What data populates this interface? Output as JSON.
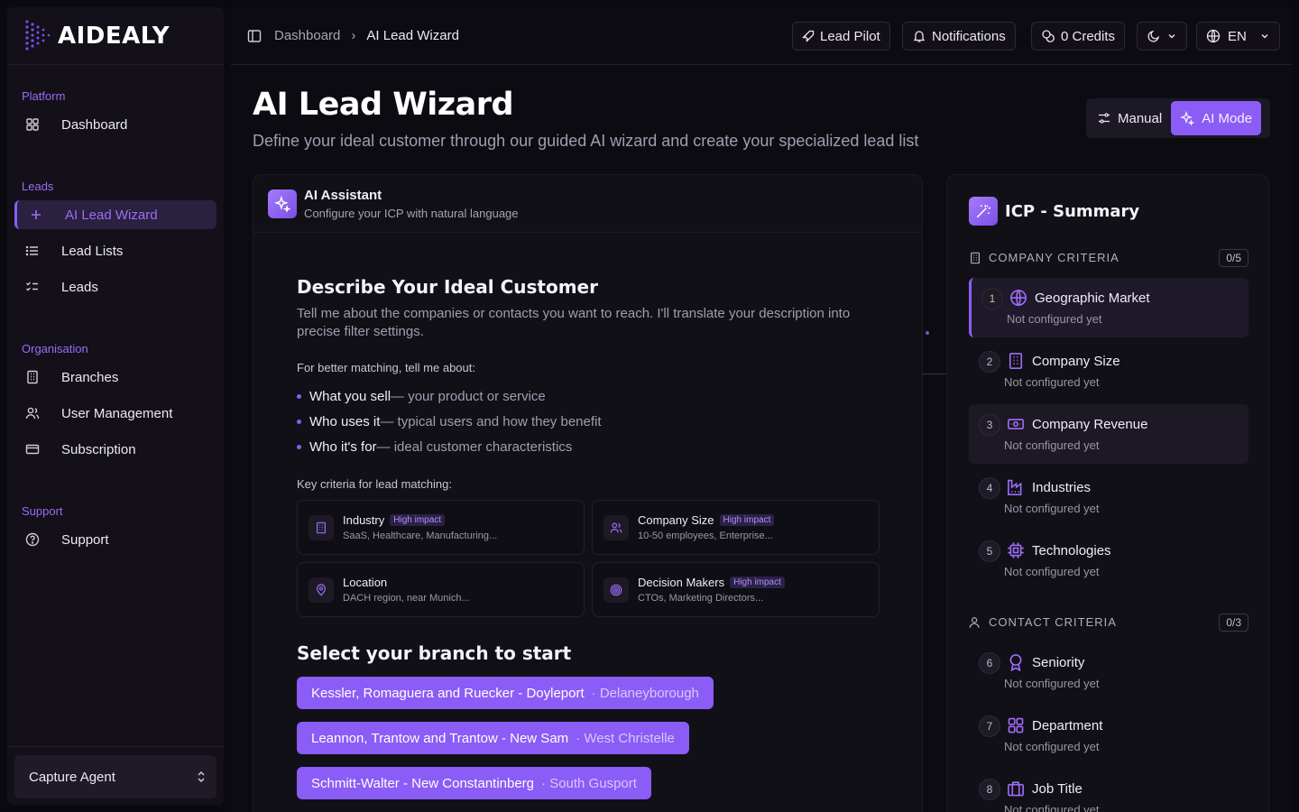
{
  "brand": {
    "name": "AIDEALY"
  },
  "sidebar": {
    "groups": [
      {
        "label": "Platform",
        "items": [
          {
            "label": "Dashboard",
            "icon": "grid-icon"
          }
        ]
      },
      {
        "label": "Leads",
        "items": [
          {
            "label": "AI Lead Wizard",
            "icon": "plus-icon",
            "active": true
          },
          {
            "label": "Lead Lists",
            "icon": "list-icon"
          },
          {
            "label": "Leads",
            "icon": "checklist-icon"
          }
        ]
      },
      {
        "label": "Organisation",
        "items": [
          {
            "label": "Branches",
            "icon": "building-icon"
          },
          {
            "label": "User Management",
            "icon": "users-icon"
          },
          {
            "label": "Subscription",
            "icon": "card-icon"
          }
        ]
      },
      {
        "label": "Support",
        "items": [
          {
            "label": "Support",
            "icon": "help-circle-icon"
          }
        ]
      }
    ],
    "agent_select": "Capture Agent"
  },
  "topbar": {
    "breadcrumb": [
      "Dashboard",
      "AI Lead Wizard"
    ],
    "lead_pilot": "Lead Pilot",
    "notifications": "Notifications",
    "credits": "0 Credits",
    "language": "EN"
  },
  "page": {
    "title": "AI Lead Wizard",
    "subtitle": "Define your ideal customer through our guided AI wizard and create your specialized lead list",
    "mode_manual": "Manual",
    "mode_ai": "AI Mode",
    "accent": "#8b5cf6"
  },
  "assistant": {
    "title": "AI Assistant",
    "subtitle": "Configure your ICP with natural language",
    "heading": "Describe Your Ideal Customer",
    "description": "Tell me about the companies or contacts you want to reach. I'll translate your description into precise filter settings.",
    "better_matching": "For better matching, tell me about:",
    "bullets": [
      {
        "strong": "What you sell",
        "rest": "— your product or service"
      },
      {
        "strong": "Who uses it",
        "rest": "— typical users and how they benefit"
      },
      {
        "strong": "Who it's for",
        "rest": "— ideal customer characteristics"
      }
    ],
    "key_criteria_label": "Key criteria for lead matching:",
    "criteria": [
      {
        "title": "Industry",
        "impact": "High impact",
        "example": "SaaS, Healthcare, Manufacturing...",
        "icon": "building-icon"
      },
      {
        "title": "Company Size",
        "impact": "High impact",
        "example": "10-50 employees, Enterprise...",
        "icon": "users-icon"
      },
      {
        "title": "Location",
        "impact": "",
        "example": "DACH region, near Munich...",
        "icon": "map-pin-icon"
      },
      {
        "title": "Decision Makers",
        "impact": "High impact",
        "example": "CTOs, Marketing Directors...",
        "icon": "target-icon"
      }
    ],
    "branch_heading": "Select your branch to start",
    "branches": [
      {
        "name": "Kessler, Romaguera and Ruecker - Doyleport",
        "city": "· Delaneyborough"
      },
      {
        "name": "Leannon, Trantow and Trantow - New Sam",
        "city": "· West Christelle"
      },
      {
        "name": "Schmitt-Walter - New Constantinberg",
        "city": "· South Gusport"
      }
    ]
  },
  "icp": {
    "title": "ICP - Summary",
    "company_label": "COMPANY CRITERIA",
    "company_count": "0/5",
    "contact_label": "CONTACT CRITERIA",
    "contact_count": "0/3",
    "items": [
      {
        "num": "1",
        "name": "Geographic Market",
        "status": "Not configured yet",
        "icon": "globe-icon"
      },
      {
        "num": "2",
        "name": "Company Size",
        "status": "Not configured yet",
        "icon": "building-icon"
      },
      {
        "num": "3",
        "name": "Company Revenue",
        "status": "Not configured yet",
        "icon": "banknote-icon"
      },
      {
        "num": "4",
        "name": "Industries",
        "status": "Not configured yet",
        "icon": "factory-icon"
      },
      {
        "num": "5",
        "name": "Technologies",
        "status": "Not configured yet",
        "icon": "cpu-icon"
      },
      {
        "num": "6",
        "name": "Seniority",
        "status": "Not configured yet",
        "icon": "award-icon"
      },
      {
        "num": "7",
        "name": "Department",
        "status": "Not configured yet",
        "icon": "grid-icon"
      },
      {
        "num": "8",
        "name": "Job Title",
        "status": "Not configured yet",
        "icon": "briefcase-icon"
      }
    ]
  }
}
